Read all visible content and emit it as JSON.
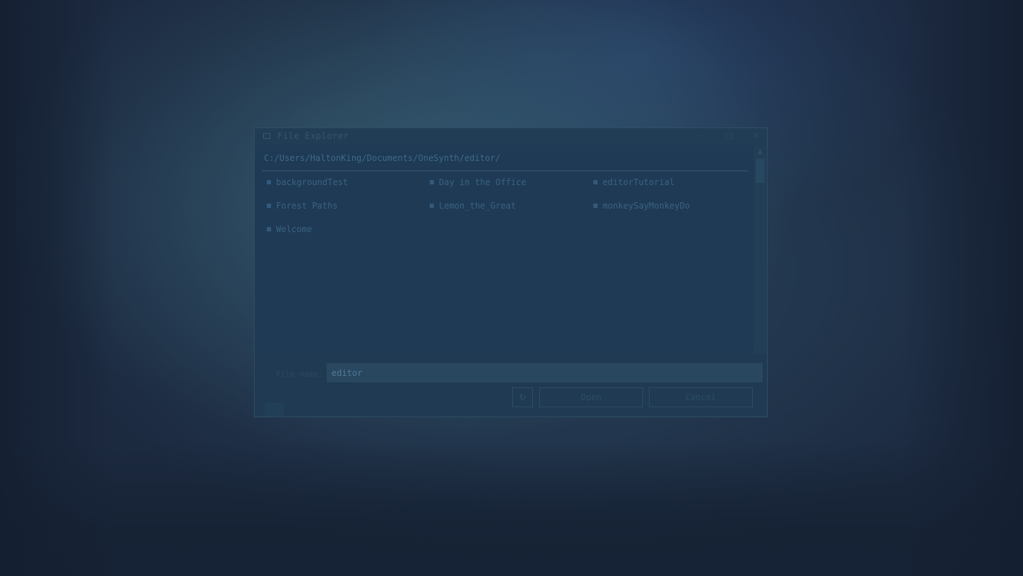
{
  "window": {
    "title": "File Explorer",
    "minimize_icon": "minimize-icon",
    "maximize_icon": "maximize-icon",
    "close_icon": "close-icon"
  },
  "browser": {
    "path": "C:/Users/HaltonKing/Documents/OneSynth/editor/",
    "items": [
      {
        "label": "backgroundTest"
      },
      {
        "label": "Day in the Office"
      },
      {
        "label": "editorTutorial"
      },
      {
        "label": "Forest Paths"
      },
      {
        "label": "Lemon_the_Great"
      },
      {
        "label": "monkeySayMonkeyDo"
      },
      {
        "label": "Welcome"
      }
    ]
  },
  "footer": {
    "filename_label": "File name:",
    "filename_value": "editor",
    "refresh_icon": "refresh-icon",
    "open_label": "Open",
    "cancel_label": "Cancel"
  },
  "colors": {
    "background": "#1c2a40",
    "window": "#1f3a52",
    "text_dim": "#3a6280"
  }
}
